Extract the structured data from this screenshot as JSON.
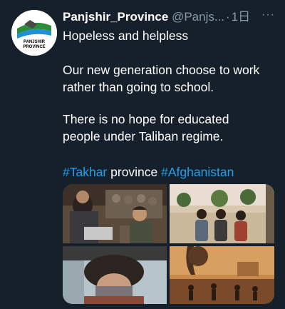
{
  "tweet": {
    "author": {
      "display_name": "Panjshir_Province",
      "handle": "@Panjs...",
      "avatar_text_line1": "PANJSHIR",
      "avatar_text_line2": "PROVINCE"
    },
    "separator": "·",
    "timestamp": "1日",
    "more_icon": "ellipsis-icon",
    "more_glyph": "···",
    "lines": {
      "line1": "Hopeless and helpless",
      "para2_line1": "Our new generation choose to work",
      "para2_line2": "rather than going to school.",
      "para3_line1": "There is no hope for educated",
      "para3_line2": "people under Taliban regime."
    },
    "hashtags": {
      "tag1": "#Takhar",
      "middle_word": " province ",
      "tag2": "#Afghanistan"
    },
    "media": {
      "photos": [
        {
          "description": "market-stall-photo"
        },
        {
          "description": "children-sitting-photo"
        },
        {
          "description": "child-with-fur-hat-photo"
        },
        {
          "description": "dusty-street-photo"
        }
      ]
    }
  },
  "colors": {
    "background": "#15202b",
    "text": "#ffffff",
    "secondary": "#8899a6",
    "link": "#1da1f2"
  }
}
